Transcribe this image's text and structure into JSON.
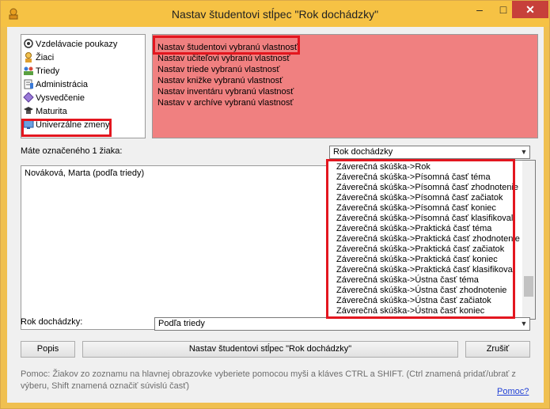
{
  "window": {
    "title": "Nastav študentovi stĺpec \"Rok dochádzky\"",
    "controls": {
      "minimize": "–",
      "maximize": "□",
      "close": "✕"
    }
  },
  "tree": {
    "items": [
      {
        "label": "Vzdelávacie poukazy",
        "icon": "voucher-icon"
      },
      {
        "label": "Žiaci",
        "icon": "students-icon"
      },
      {
        "label": "Triedy",
        "icon": "classes-icon"
      },
      {
        "label": "Administrácia",
        "icon": "admin-icon"
      },
      {
        "label": "Vysvedčenie",
        "icon": "certificate-icon"
      },
      {
        "label": "Maturita",
        "icon": "graduation-icon"
      },
      {
        "label": "Univerzálne zmeny",
        "icon": "universal-changes-icon"
      }
    ]
  },
  "actions": {
    "items": [
      "Nastav študentovi vybranú vlastnosť",
      "Nastav učiteľovi vybranú vlastnosť",
      "Nastav triede vybranú vlastnosť",
      "Nastav knižke vybranú vlastnosť",
      "Nastav inventáru vybranú vlastnosť",
      "Nastav v archíve vybranú vlastnosť"
    ]
  },
  "selection": {
    "label": "Máte označeného 1 žiaka:",
    "students": [
      "Nováková, Marta (podľa triedy)"
    ]
  },
  "column_combo": {
    "value": "Rok dochádzky",
    "options": [
      "Záverečná skúška->Rok",
      "Záverečná skúška->Písomná časť téma",
      "Záverečná skúška->Písomná časť zhodnotenie",
      "Záverečná skúška->Písomná časť začiatok",
      "Záverečná skúška->Písomná časť koniec",
      "Záverečná skúška->Písomná časť klasifikoval",
      "Záverečná skúška->Praktická časť téma",
      "Záverečná skúška->Praktická časť zhodnotenie",
      "Záverečná skúška->Praktická časť začiatok",
      "Záverečná skúška->Praktická časť koniec",
      "Záverečná skúška->Praktická časť klasifikoval",
      "Záverečná skúška->Ústna časť téma",
      "Záverečná skúška->Ústna časť zhodnotenie",
      "Záverečná skúška->Ústna časť začiatok",
      "Záverečná skúška->Ústna časť koniec"
    ]
  },
  "value_row": {
    "label": "Rok dochádzky:",
    "value": "Podľa triedy"
  },
  "buttons": {
    "describe": "Popis",
    "apply": "Nastav študentovi stĺpec \"Rok dochádzky\"",
    "cancel": "Zrušiť"
  },
  "help": {
    "text": "Pomoc: Žiakov zo zoznamu na hlavnej obrazovke vyberiete pomocou myši a kláves CTRL a SHIFT. (Ctrl znamená pridať/ubrať z výberu, Shift znamená označiť súvislú časť)",
    "link": "Pomoc?"
  },
  "colors": {
    "titlebar": "#f6c244",
    "action_list_bg": "#f08080",
    "highlight": "#e3161f",
    "close_button": "#c7403a"
  }
}
